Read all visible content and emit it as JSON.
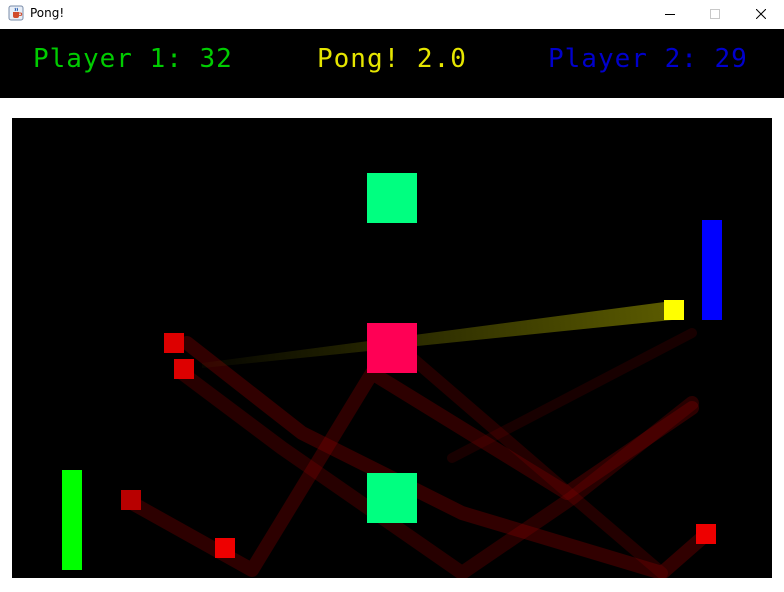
{
  "window": {
    "title": "Pong!",
    "app_icon": "java-cup-icon",
    "controls": [
      "minimize-icon",
      "maximize-icon",
      "close-icon"
    ]
  },
  "header": {
    "player1": {
      "label": "Player 1: 32",
      "color": "#00cc00"
    },
    "title": {
      "label": "Pong! 2.0",
      "color": "#e6e600"
    },
    "player2": {
      "label": "Player 2: 29",
      "color": "#0000cc"
    }
  },
  "colors": {
    "background": "#000000",
    "left_paddle": "#00ff00",
    "right_paddle": "#0000ff",
    "main_ball": "#ffff00",
    "extra_balls": "#dd0000",
    "obstacle_green": "#00ff80",
    "obstacle_pink": "#ff0055",
    "ball_trail_red": "#8b0000",
    "ball_trail_yellow": "#6b6b00"
  }
}
